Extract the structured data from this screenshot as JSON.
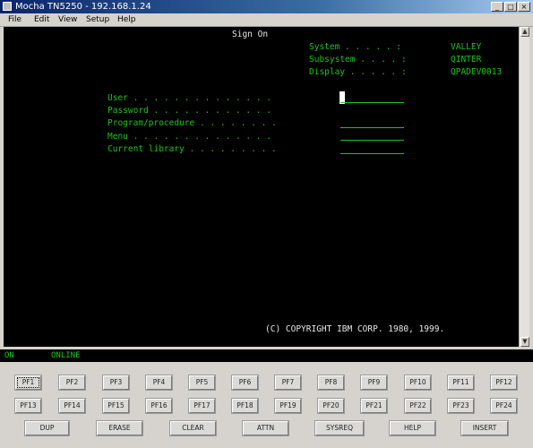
{
  "window": {
    "title": "Mocha TN5250 - 192.168.1.24",
    "minimize": "_",
    "maximize": "□",
    "close": "×"
  },
  "menu": [
    "File",
    "Edit",
    "View",
    "Setup",
    "Help"
  ],
  "screen": {
    "heading": "Sign On",
    "system_label": "System . . . . . :",
    "system_value": "VALLEY",
    "subsystem_label": "Subsystem . . . . :",
    "subsystem_value": "QINTER",
    "display_label": "Display . . . . . :",
    "display_value": "QPADEV0013",
    "fields": [
      "User . . . . . . . . . . . . . .",
      "Password . . . . . . . . . . . .",
      "Program/procedure . . . . . . . .",
      "Menu . . . . . . . . . . . . . .",
      "Current library . . . . . . . . ."
    ],
    "copyright": "(C) COPYRIGHT IBM CORP. 1980, 1999."
  },
  "status": {
    "left": "ON",
    "mode": "ONLINE"
  },
  "keypad": {
    "row1": [
      "PF1",
      "PF2",
      "PF3",
      "PF4",
      "PF5",
      "PF6",
      "PF7",
      "PF8",
      "PF9",
      "PF10",
      "PF11",
      "PF12"
    ],
    "row2": [
      "PF13",
      "PF14",
      "PF15",
      "PF16",
      "PF17",
      "PF18",
      "PF19",
      "PF20",
      "PF21",
      "PF22",
      "PF23",
      "PF24"
    ],
    "row3": [
      "DUP",
      "ERASE",
      "CLEAR",
      "ATTN",
      "SYSREQ",
      "HELP",
      "INSERT"
    ]
  }
}
